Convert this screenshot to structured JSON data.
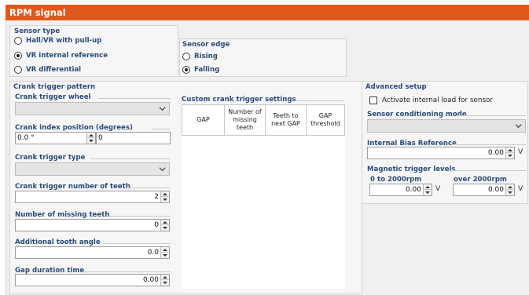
{
  "window": {
    "title": "RPM signal"
  },
  "sensor_type": {
    "title": "Sensor type",
    "options": [
      {
        "label": "Hall/VR with pull-up",
        "selected": false
      },
      {
        "label": "VR internal reference",
        "selected": true
      },
      {
        "label": "VR differential",
        "selected": false
      }
    ]
  },
  "sensor_edge": {
    "title": "Sensor edge",
    "options": [
      {
        "label": "Rising",
        "selected": false
      },
      {
        "label": "Falling",
        "selected": true
      }
    ]
  },
  "crank": {
    "title": "Crank trigger pattern",
    "wheel_label": "Crank trigger wheel",
    "wheel_value": "",
    "index_label": "Crank index position (degrees)",
    "index_value": "0.0 °",
    "index_right_value": "0",
    "type_label": "Crank trigger type",
    "type_value": "",
    "teeth_label": "Crank trigger number of teeth",
    "teeth_value": "2",
    "missing_label": "Number of missing teeth",
    "missing_value": "0",
    "angle_label": "Additional tooth angle",
    "angle_value": "0.0",
    "gap_label": "Gap duration time",
    "gap_value": "0.00"
  },
  "custom": {
    "title": "Custom crank trigger settings",
    "columns": [
      "GAP",
      "Number of missing teeth",
      "Teeth to next GAP",
      "GAP threshold"
    ]
  },
  "advanced": {
    "title": "Advanced setup",
    "internal_load_label": "Activate internal load for sensor",
    "internal_load_checked": false,
    "conditioning_label": "Sensor conditioning mode",
    "conditioning_value": "",
    "bias_label": "Internal Bias Reference",
    "bias_value": "0.00",
    "bias_unit": "V",
    "magnetic_label": "Magnetic trigger levels",
    "low_label": "0 to 2000rpm",
    "low_value": "0.00",
    "low_unit": "V",
    "high_label": "over 2000rpm",
    "high_value": "0.00",
    "high_unit": "V"
  },
  "colors": {
    "title_bar": "#e0591c",
    "group_label": "#2b4a7a",
    "background": "#f0f0f0"
  }
}
